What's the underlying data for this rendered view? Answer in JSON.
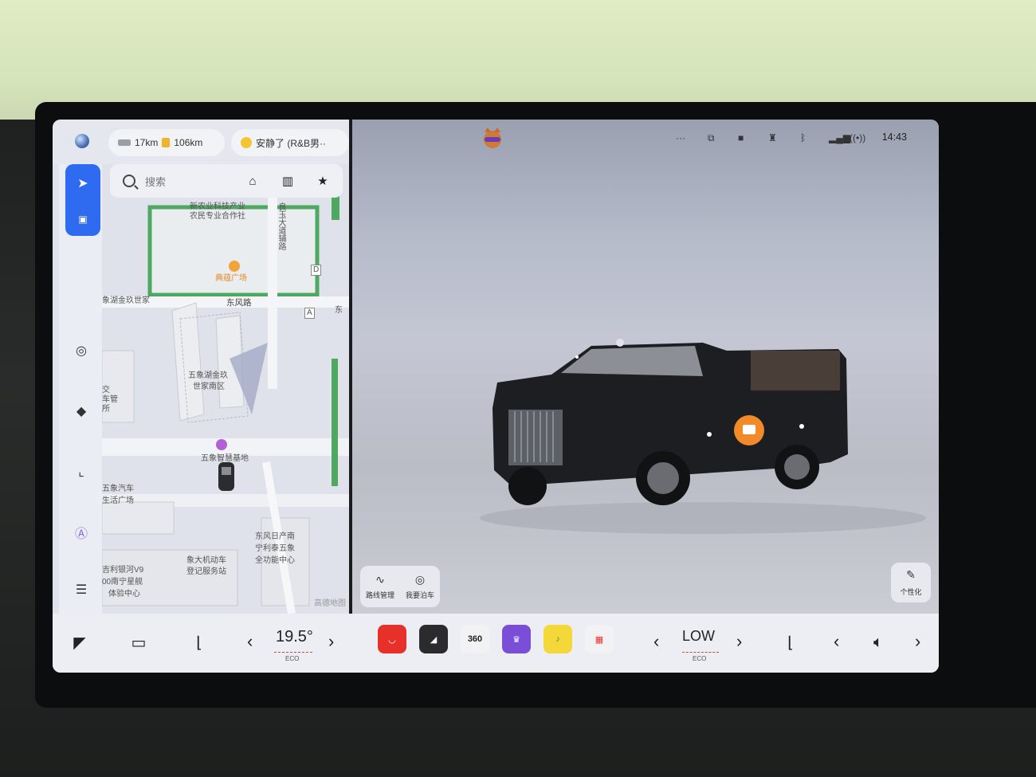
{
  "map": {
    "range_electric": "17km",
    "range_fuel": "106km",
    "music_text": "安静了 (R&B男··",
    "search_placeholder": "搜索",
    "labels": {
      "l1": "新农业科技产业",
      "l2": "农民专业合作社",
      "l3": "良玉大道辅路",
      "l4": "典蕴广场",
      "l5": "象湖金玖世家",
      "l6": "东风路",
      "l7": "东",
      "l8": "五象湖金玖",
      "l9": "世家南区",
      "l10": "五象智慧基地",
      "l11": "五象汽车",
      "l12": "生活广场",
      "l13": "东风日产南",
      "l14": "宁利泰五象",
      "l15": "全功能中心",
      "l16": "象大机动车",
      "l17": "登记服务站",
      "l18": "吉利银河V9",
      "l19": "00南宁星舰",
      "l20": "体验中心",
      "l21": "交",
      "l22": "车管",
      "l23": "所",
      "l24": "高德地图",
      "marker_d": "D",
      "marker_a": "A"
    }
  },
  "status": {
    "time": "14:43",
    "more": "···"
  },
  "quick_actions": {
    "route": "路线管理",
    "park": "我要泊车"
  },
  "personalize": "个性化",
  "dock": {
    "temp_left": "19.5°",
    "temp_left_mode": "ECO",
    "fan": "LOW",
    "fan_mode": "ECO",
    "app_360": "360"
  },
  "colors": {
    "accent_blue": "#2e6bf0",
    "orange_pin": "#f28a2a"
  }
}
